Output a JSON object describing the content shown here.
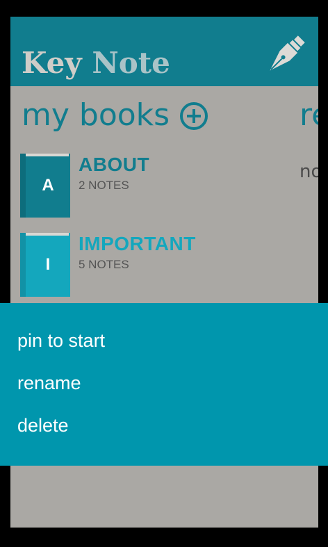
{
  "app": {
    "title_part1": "Key ",
    "title_part2": "Note"
  },
  "icons": {
    "header": "pen-nib-icon",
    "add": "plus-circle-icon"
  },
  "colors": {
    "accent": "#117d8e",
    "menu_background": "#0096ad",
    "background": "#aaa8a4"
  },
  "section": {
    "title": "my books",
    "peek_title": "re",
    "peek_sub": "no"
  },
  "books": [
    {
      "letter": "A",
      "name": "ABOUT",
      "count": "2 NOTES",
      "color": "#117d8e"
    },
    {
      "letter": "I",
      "name": "IMPORTANT",
      "count": "5 NOTES",
      "color": "#14a7bd"
    }
  ],
  "context_menu": {
    "items": [
      "pin to start",
      "rename",
      "delete"
    ]
  }
}
